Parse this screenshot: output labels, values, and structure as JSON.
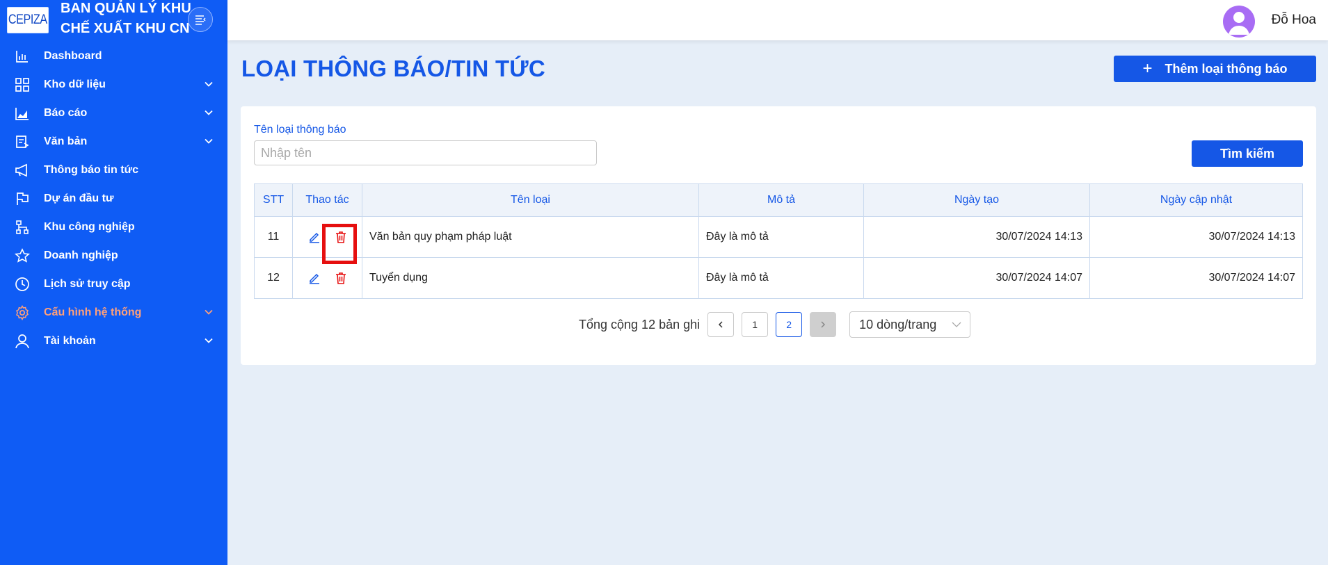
{
  "sidebar": {
    "logo_text": "CEPIZA",
    "brand_line1": "BAN QUẢN LÝ KHU",
    "brand_line2": "CHẾ XUẤT KHU CN",
    "items": [
      {
        "label": "Dashboard",
        "icon": "bar-chart-icon",
        "has_submenu": false
      },
      {
        "label": "Kho dữ liệu",
        "icon": "grid-icon",
        "has_submenu": true
      },
      {
        "label": "Báo cáo",
        "icon": "area-chart-icon",
        "has_submenu": true
      },
      {
        "label": "Văn bản",
        "icon": "document-icon",
        "has_submenu": true
      },
      {
        "label": "Thông báo tin tức",
        "icon": "megaphone-icon",
        "has_submenu": false
      },
      {
        "label": "Dự án đầu tư",
        "icon": "flag-icon",
        "has_submenu": false
      },
      {
        "label": "Khu công nghiệp",
        "icon": "sitemap-icon",
        "has_submenu": false
      },
      {
        "label": "Doanh nghiệp",
        "icon": "star-icon",
        "has_submenu": false
      },
      {
        "label": "Lịch sử truy cập",
        "icon": "clock-icon",
        "has_submenu": false
      },
      {
        "label": "Cấu hình hệ thống",
        "icon": "gear-icon",
        "has_submenu": true,
        "active": true
      },
      {
        "label": "Tài khoản",
        "icon": "user-icon",
        "has_submenu": true
      }
    ]
  },
  "header": {
    "username": "Đỗ Hoa"
  },
  "page": {
    "title": "LOẠI THÔNG BÁO/TIN TỨC",
    "add_button": "Thêm loại thông báo"
  },
  "filter": {
    "label": "Tên loại thông báo",
    "placeholder": "Nhập tên",
    "value": "",
    "search_button": "Tìm kiếm"
  },
  "table": {
    "columns": [
      "STT",
      "Thao tác",
      "Tên loại",
      "Mô tả",
      "Ngày tạo",
      "Ngày cập nhật"
    ],
    "rows": [
      {
        "stt": "11",
        "name": "Văn bản quy phạm pháp luật",
        "desc": "Đây là mô tả",
        "created": "30/07/2024 14:13",
        "updated": "30/07/2024 14:13"
      },
      {
        "stt": "12",
        "name": "Tuyển dụng",
        "desc": "Đây là mô tả",
        "created": "30/07/2024 14:07",
        "updated": "30/07/2024 14:07"
      }
    ]
  },
  "pagination": {
    "total_text": "Tổng cộng 12 bản ghi",
    "pages": [
      "1",
      "2"
    ],
    "current_page": "2",
    "page_size": "10 dòng/trang"
  },
  "colors": {
    "primary": "#1557e6",
    "sidebar_bg": "#0f5cf5",
    "active_menu": "#ffa07a",
    "delete_red": "#e60f0f",
    "avatar_bg": "#a86cf4"
  }
}
